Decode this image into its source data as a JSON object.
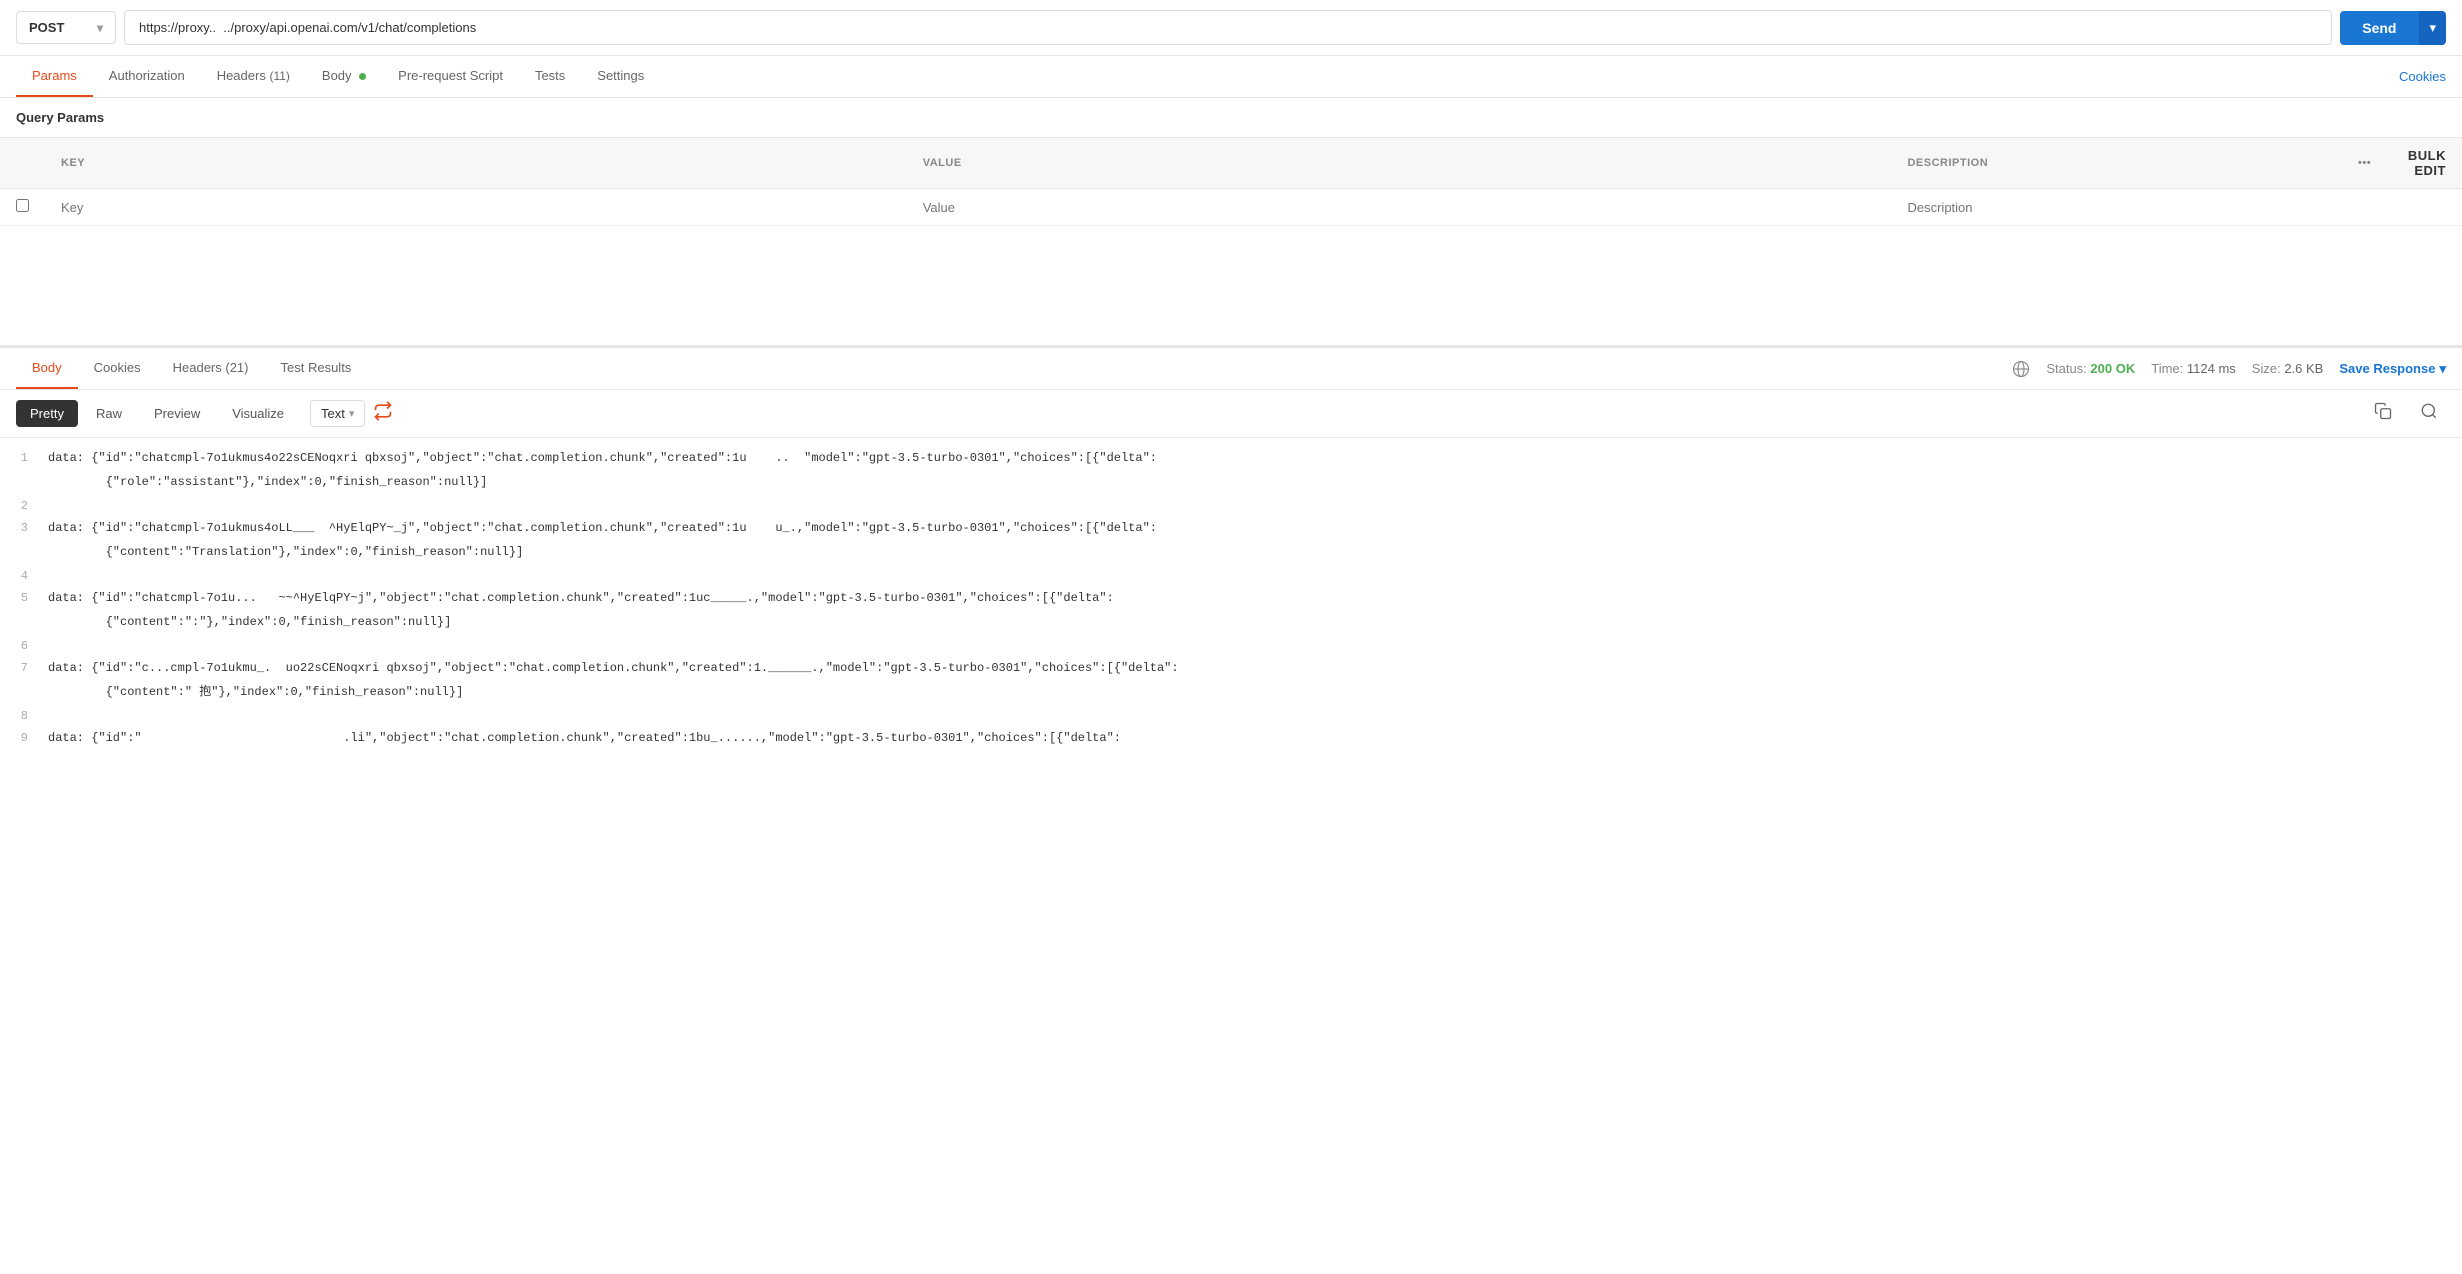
{
  "topbar": {
    "method": "POST",
    "method_chevron": "▾",
    "url": "https://proxy..  ../proxy/api.openai.com/v1/chat/completions",
    "send_label": "Send",
    "send_arrow": "▾"
  },
  "tabs": {
    "items": [
      {
        "id": "params",
        "label": "Params",
        "active": true
      },
      {
        "id": "authorization",
        "label": "Authorization",
        "active": false
      },
      {
        "id": "headers",
        "label": "Headers",
        "badge": "(11)",
        "active": false
      },
      {
        "id": "body",
        "label": "Body",
        "has_dot": true,
        "active": false
      },
      {
        "id": "prerequest",
        "label": "Pre-request Script",
        "active": false
      },
      {
        "id": "tests",
        "label": "Tests",
        "active": false
      },
      {
        "id": "settings",
        "label": "Settings",
        "active": false
      }
    ],
    "cookies_label": "Cookies"
  },
  "query_params": {
    "section_label": "Query Params",
    "columns": {
      "key": "KEY",
      "value": "VALUE",
      "description": "DESCRIPTION",
      "bulk_edit": "Bulk Edit"
    },
    "placeholder_key": "Key",
    "placeholder_value": "Value",
    "placeholder_desc": "Description"
  },
  "bottom": {
    "tabs": [
      {
        "id": "body",
        "label": "Body",
        "active": true
      },
      {
        "id": "cookies",
        "label": "Cookies",
        "active": false
      },
      {
        "id": "headers",
        "label": "Headers",
        "badge": "(21)",
        "active": false
      },
      {
        "id": "test_results",
        "label": "Test Results",
        "active": false
      }
    ],
    "status_label": "Status:",
    "status_value": "200 OK",
    "time_label": "Time:",
    "time_value": "1124 ms",
    "size_label": "Size:",
    "size_value": "2.6 KB",
    "save_response_label": "Save Response",
    "save_chevron": "▾"
  },
  "format_bar": {
    "pretty_label": "Pretty",
    "raw_label": "Raw",
    "preview_label": "Preview",
    "visualize_label": "Visualize",
    "format_select": "Text",
    "format_chevron": "▾"
  },
  "response_lines": [
    {
      "num": "1",
      "content": "data: {\"id\":\"chatcmpl-7o1ukmus4o22sCENoqxri qbxsoj\",\"object\":\"chat.completion.chunk\",\"created\":1u    ..  \"model\":\"gpt-3.5-turbo-0301\",\"choices\":[{\"delta\":",
      "continuation": "        {\"role\":\"assistant\"},\"index\":0,\"finish_reason\":null}]"
    },
    {
      "num": "2",
      "content": "",
      "continuation": ""
    },
    {
      "num": "3",
      "content": "data: {\"id\":\"chatcmpl-7o1ukmus4oLL___  ^HyElqPY~_j\",\"object\":\"chat.completion.chunk\",\"created\":1u    u_.,\"model\":\"gpt-3.5-turbo-0301\",\"choices\":[{\"delta\":",
      "continuation": "        {\"content\":\"Translation\"},\"index\":0,\"finish_reason\":null}]"
    },
    {
      "num": "4",
      "content": "",
      "continuation": ""
    },
    {
      "num": "5",
      "content": "data: {\"id\":\"chatcmpl-7o1u...   ~~^HyElqPY~j\",\"object\":\"chat.completion.chunk\",\"created\":1uc_____.,\"model\":\"gpt-3.5-turbo-0301\",\"choices\":[{\"delta\":",
      "continuation": "        {\"content\":\":\"},\"index\":0,\"finish_reason\":null}]"
    },
    {
      "num": "6",
      "content": "",
      "continuation": ""
    },
    {
      "num": "7",
      "content": "data: {\"id\":\"c...cmpl-7o1ukmu_.  uo22sCENoqxri qbxsoj\",\"object\":\"chat.completion.chunk\",\"created\":1.______.,\"model\":\"gpt-3.5-turbo-0301\",\"choices\":[{\"delta\":",
      "continuation": "        {\"content\":\" 抱\"},\"index\":0,\"finish_reason\":null}]"
    },
    {
      "num": "8",
      "content": "",
      "continuation": ""
    },
    {
      "num": "9",
      "content": "data: {\"id\":\"                            .li\",\"object\":\"chat.completion.chunk\",\"created\":1bu_......,\"model\":\"gpt-3.5-turbo-0301\",\"choices\":[{\"delta\":",
      "continuation": ""
    }
  ]
}
